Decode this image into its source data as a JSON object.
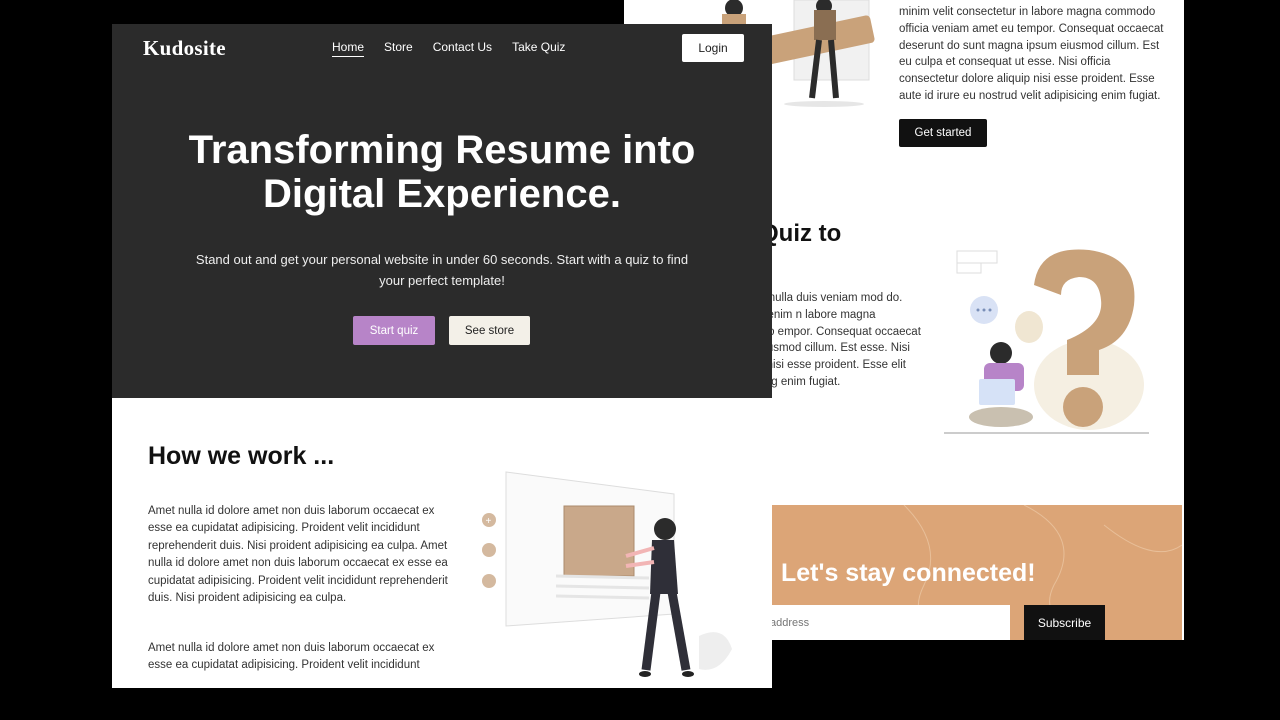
{
  "back_page": {
    "top_paragraph": "minim velit consectetur in labore magna commodo officia veniam amet eu tempor. Consequat occaecat deserunt do sunt magna ipsum eiusmod cillum. Est eu culpa et consequat ut esse. Nisi officia consectetur dolore aliquip nisi esse proident. Esse aute id irure eu nostrud velit adipisicing enim fugiat.",
    "get_started_label": "Get started",
    "quiz_heading": "gn Quiz to",
    "quiz_paragraph": "olore do nulla duis veniam mod do. Pariatur enim n labore magna commodo empor. Consequat occaecat ipsum eiusmod cillum. Est esse. Nisi officia p nisi esse proident. Esse elit adipisicing enim fugiat.",
    "cta_title": "Let's stay connected!",
    "email_placeholder": "address",
    "subscribe_label": "Subscribe"
  },
  "front_page": {
    "logo": "Kudosite",
    "nav": [
      {
        "label": "Home",
        "active": true
      },
      {
        "label": "Store",
        "active": false
      },
      {
        "label": "Contact Us",
        "active": false
      },
      {
        "label": "Take Quiz",
        "active": false
      }
    ],
    "login_label": "Login",
    "hero_title": "Transforming Resume into Digital Experience.",
    "hero_subtitle": "Stand out and get your personal website in under 60 seconds. Start with a quiz to find your perfect template!",
    "start_quiz_label": "Start quiz",
    "see_store_label": "See store",
    "how_heading": "How we work ...",
    "how_paragraph_1": "Amet nulla id dolore amet non duis laborum occaecat ex esse ea cupidatat adipisicing. Proident velit incididunt reprehenderit duis. Nisi proident adipisicing ea culpa. Amet nulla id dolore amet non duis laborum occaecat ex esse ea cupidatat adipisicing. Proident velit incididunt reprehenderit duis. Nisi proident adipisicing ea culpa.",
    "how_paragraph_2": "Amet nulla id dolore amet non duis laborum occaecat ex esse ea cupidatat adipisicing. Proident velit incididunt"
  },
  "colors": {
    "hero_bg": "#2b2b2b",
    "accent_purple": "#b784c8",
    "cta_tan": "#dca577",
    "dark_button": "#111111"
  }
}
